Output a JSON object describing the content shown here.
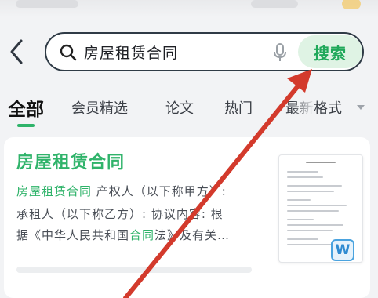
{
  "search": {
    "query": "房屋租赁合同",
    "button_label": "搜索"
  },
  "tabs": {
    "items": [
      "全部",
      "会员精选",
      "论文",
      "热门",
      "最新"
    ],
    "format_label": "格式"
  },
  "result": {
    "title": "房屋租赁合同",
    "line1_hl": "房屋租赁合同",
    "line1_rest": " 产权人（以下称甲方）:",
    "line2": "承租人（以下称乙方）: 协议内容: 根",
    "line3_a": "据《中华人民共和国",
    "line3_hl": "合同",
    "line3_b": "法》及有关…",
    "file_type": "W"
  },
  "colors": {
    "accent_green": "#2fb36a",
    "arrow_red": "#d33a2c",
    "word_blue": "#2f8bd1"
  }
}
